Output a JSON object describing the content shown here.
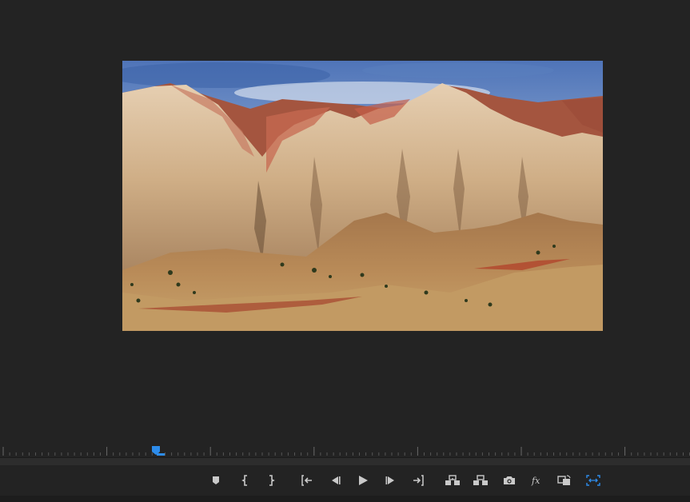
{
  "app": {
    "panel": "program-monitor"
  },
  "video": {
    "description_icon": "video-frame"
  },
  "timeline": {
    "playhead_position": 0.23
  },
  "transport": {
    "buttons": [
      {
        "name": "add-marker-button",
        "icon": "marker-icon"
      },
      {
        "name": "mark-in-button",
        "icon": "mark-in-icon"
      },
      {
        "name": "mark-out-button",
        "icon": "mark-out-icon"
      },
      {
        "name": "go-to-in-button",
        "icon": "go-to-in-icon"
      },
      {
        "name": "step-back-button",
        "icon": "step-back-icon"
      },
      {
        "name": "play-button",
        "icon": "play-icon"
      },
      {
        "name": "step-forward-button",
        "icon": "step-forward-icon"
      },
      {
        "name": "go-to-out-button",
        "icon": "go-to-out-icon"
      },
      {
        "name": "lift-button",
        "icon": "lift-icon"
      },
      {
        "name": "extract-button",
        "icon": "extract-icon"
      },
      {
        "name": "export-frame-button",
        "icon": "camera-icon"
      },
      {
        "name": "effects-button",
        "icon": "fx-icon"
      },
      {
        "name": "comparison-view-button",
        "icon": "comparison-icon"
      },
      {
        "name": "safe-margins-button",
        "icon": "safe-margins-icon"
      }
    ]
  },
  "colors": {
    "background": "#232323",
    "accent": "#2d8ceb",
    "icon": "#c9c9c9"
  }
}
